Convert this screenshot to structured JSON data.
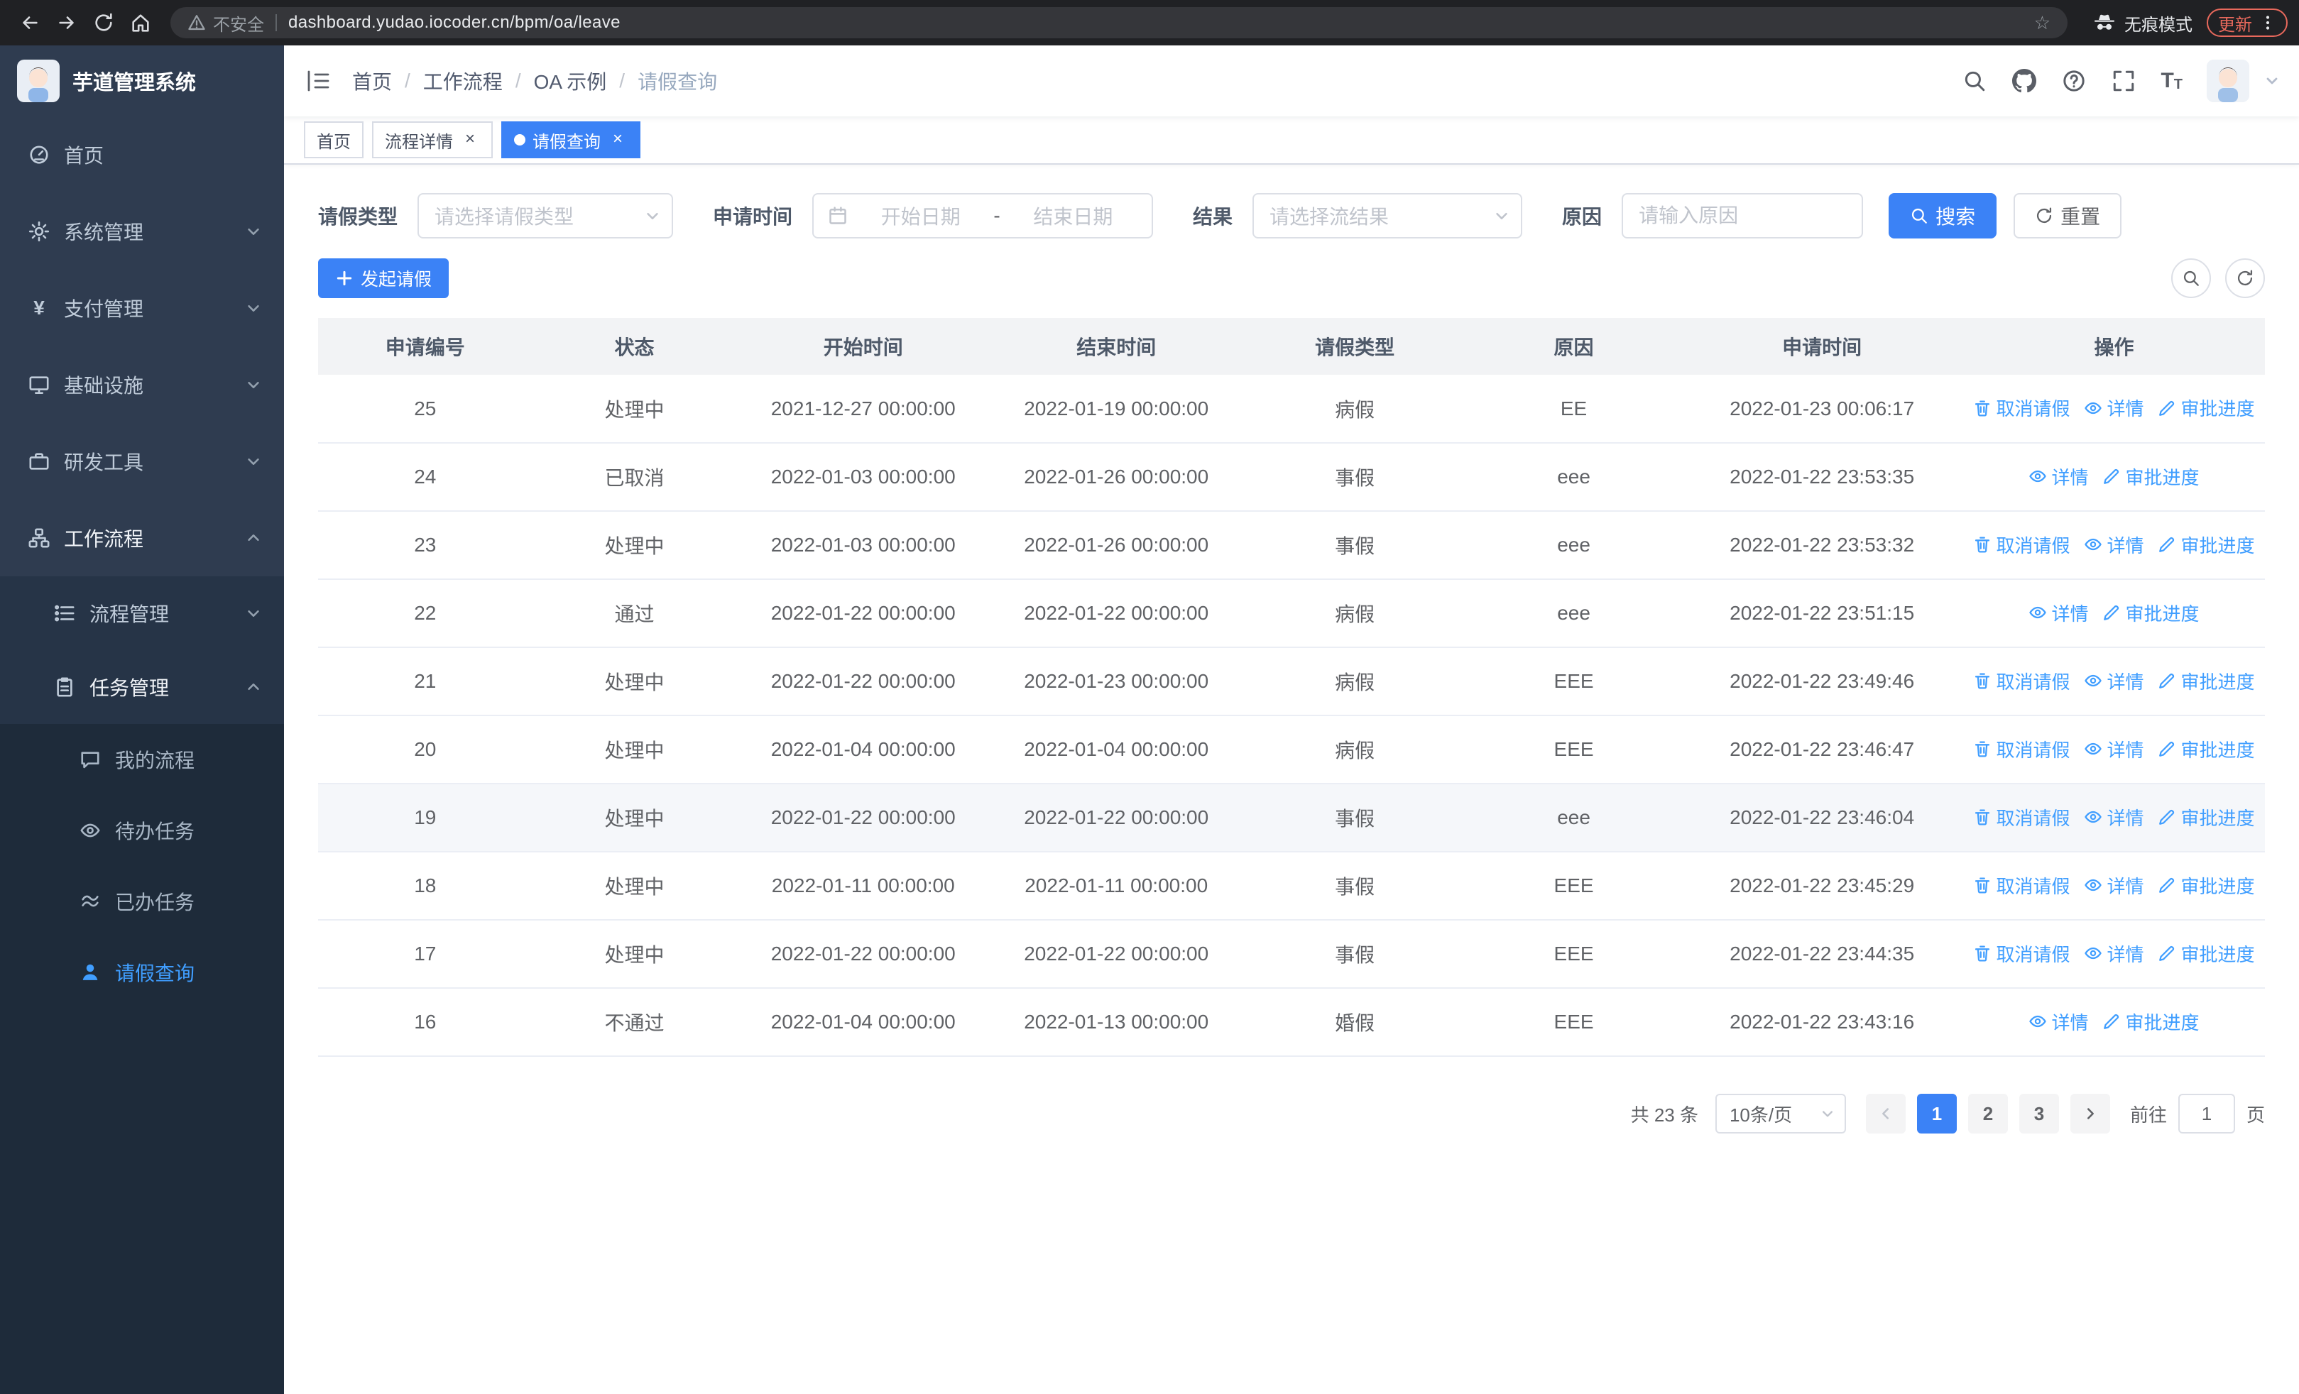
{
  "browser": {
    "security_label": "不安全",
    "url": "dashboard.yudao.iocoder.cn/bpm/oa/leave",
    "incognito_label": "无痕模式",
    "update_label": "更新"
  },
  "sidebar": {
    "logo_title": "芋道管理系统",
    "items": [
      {
        "label": "首页"
      },
      {
        "label": "系统管理"
      },
      {
        "label": "支付管理"
      },
      {
        "label": "基础设施"
      },
      {
        "label": "研发工具"
      },
      {
        "label": "工作流程"
      }
    ],
    "workflow_submenu": [
      {
        "label": "流程管理"
      },
      {
        "label": "任务管理"
      }
    ],
    "task_submenu": [
      {
        "label": "我的流程"
      },
      {
        "label": "待办任务"
      },
      {
        "label": "已办任务"
      },
      {
        "label": "请假查询"
      }
    ]
  },
  "header": {
    "breadcrumb": [
      "首页",
      "工作流程",
      "OA 示例",
      "请假查询"
    ]
  },
  "tabs": [
    {
      "label": "首页",
      "active": false,
      "closable": false
    },
    {
      "label": "流程详情",
      "active": false,
      "closable": true
    },
    {
      "label": "请假查询",
      "active": true,
      "closable": true
    }
  ],
  "filters": {
    "leave_type_label": "请假类型",
    "leave_type_placeholder": "请选择请假类型",
    "apply_time_label": "申请时间",
    "start_date_placeholder": "开始日期",
    "range_separator": "-",
    "end_date_placeholder": "结束日期",
    "result_label": "结果",
    "result_placeholder": "请选择流结果",
    "reason_label": "原因",
    "reason_placeholder": "请输入原因",
    "search_label": "搜索",
    "reset_label": "重置"
  },
  "toolbar": {
    "create_label": "发起请假"
  },
  "table": {
    "columns": [
      "申请编号",
      "状态",
      "开始时间",
      "结束时间",
      "请假类型",
      "原因",
      "申请时间",
      "操作"
    ],
    "action_labels": {
      "cancel": "取消请假",
      "detail": "详情",
      "progress": "审批进度"
    },
    "rows": [
      {
        "id": "25",
        "status": "处理中",
        "start": "2021-12-27 00:00:00",
        "end": "2022-01-19 00:00:00",
        "type": "病假",
        "reason": "EE",
        "applied": "2022-01-23 00:06:17",
        "actions": [
          "cancel",
          "detail",
          "progress"
        ],
        "highlighted": false
      },
      {
        "id": "24",
        "status": "已取消",
        "start": "2022-01-03 00:00:00",
        "end": "2022-01-26 00:00:00",
        "type": "事假",
        "reason": "eee",
        "applied": "2022-01-22 23:53:35",
        "actions": [
          "detail",
          "progress"
        ],
        "highlighted": false
      },
      {
        "id": "23",
        "status": "处理中",
        "start": "2022-01-03 00:00:00",
        "end": "2022-01-26 00:00:00",
        "type": "事假",
        "reason": "eee",
        "applied": "2022-01-22 23:53:32",
        "actions": [
          "cancel",
          "detail",
          "progress"
        ],
        "highlighted": false
      },
      {
        "id": "22",
        "status": "通过",
        "start": "2022-01-22 00:00:00",
        "end": "2022-01-22 00:00:00",
        "type": "病假",
        "reason": "eee",
        "applied": "2022-01-22 23:51:15",
        "actions": [
          "detail",
          "progress"
        ],
        "highlighted": false
      },
      {
        "id": "21",
        "status": "处理中",
        "start": "2022-01-22 00:00:00",
        "end": "2022-01-23 00:00:00",
        "type": "病假",
        "reason": "EEE",
        "applied": "2022-01-22 23:49:46",
        "actions": [
          "cancel",
          "detail",
          "progress"
        ],
        "highlighted": false
      },
      {
        "id": "20",
        "status": "处理中",
        "start": "2022-01-04 00:00:00",
        "end": "2022-01-04 00:00:00",
        "type": "病假",
        "reason": "EEE",
        "applied": "2022-01-22 23:46:47",
        "actions": [
          "cancel",
          "detail",
          "progress"
        ],
        "highlighted": false
      },
      {
        "id": "19",
        "status": "处理中",
        "start": "2022-01-22 00:00:00",
        "end": "2022-01-22 00:00:00",
        "type": "事假",
        "reason": "eee",
        "applied": "2022-01-22 23:46:04",
        "actions": [
          "cancel",
          "detail",
          "progress"
        ],
        "highlighted": true
      },
      {
        "id": "18",
        "status": "处理中",
        "start": "2022-01-11 00:00:00",
        "end": "2022-01-11 00:00:00",
        "type": "事假",
        "reason": "EEE",
        "applied": "2022-01-22 23:45:29",
        "actions": [
          "cancel",
          "detail",
          "progress"
        ],
        "highlighted": false
      },
      {
        "id": "17",
        "status": "处理中",
        "start": "2022-01-22 00:00:00",
        "end": "2022-01-22 00:00:00",
        "type": "事假",
        "reason": "EEE",
        "applied": "2022-01-22 23:44:35",
        "actions": [
          "cancel",
          "detail",
          "progress"
        ],
        "highlighted": false
      },
      {
        "id": "16",
        "status": "不通过",
        "start": "2022-01-04 00:00:00",
        "end": "2022-01-13 00:00:00",
        "type": "婚假",
        "reason": "EEE",
        "applied": "2022-01-22 23:43:16",
        "actions": [
          "detail",
          "progress"
        ],
        "highlighted": false
      }
    ]
  },
  "pagination": {
    "total_label": "共 23 条",
    "page_size_label": "10条/页",
    "pages": [
      "1",
      "2",
      "3"
    ],
    "active_page": "1",
    "goto_label": "前往",
    "goto_value": "1",
    "page_unit_label": "页"
  },
  "colors": {
    "accent": "#3b82f6",
    "link": "#409eff",
    "sidebar_bg": "#1e2b3a",
    "update_pill": "#e8695c"
  }
}
